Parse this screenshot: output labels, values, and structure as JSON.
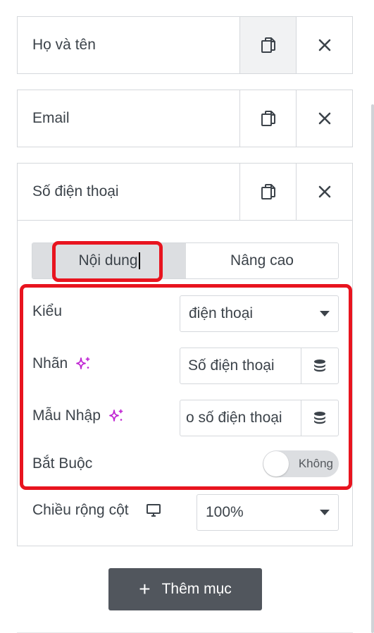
{
  "items": [
    {
      "title": "Họ và tên"
    },
    {
      "title": "Email"
    },
    {
      "title": "Số điện thoại"
    }
  ],
  "tabs": {
    "content": "Nội dung",
    "advanced": "Nâng cao"
  },
  "fields": {
    "type": {
      "label": "Kiểu",
      "value": "điện thoại"
    },
    "label": {
      "label": "Nhãn",
      "value": "Số điện thoại"
    },
    "placeholder": {
      "label": "Mẫu Nhập",
      "value": "o số điện thoại"
    },
    "required": {
      "label": "Bắt Buộc",
      "toggle_text": "Không",
      "on": false
    },
    "column_width": {
      "label": "Chiều rộng cột",
      "value": "100%"
    }
  },
  "add_button": {
    "label": "Thêm mục"
  },
  "colors": {
    "highlight": "#e8141f",
    "ai_sparkle": "#c026d3",
    "button_bg": "#51565d"
  }
}
